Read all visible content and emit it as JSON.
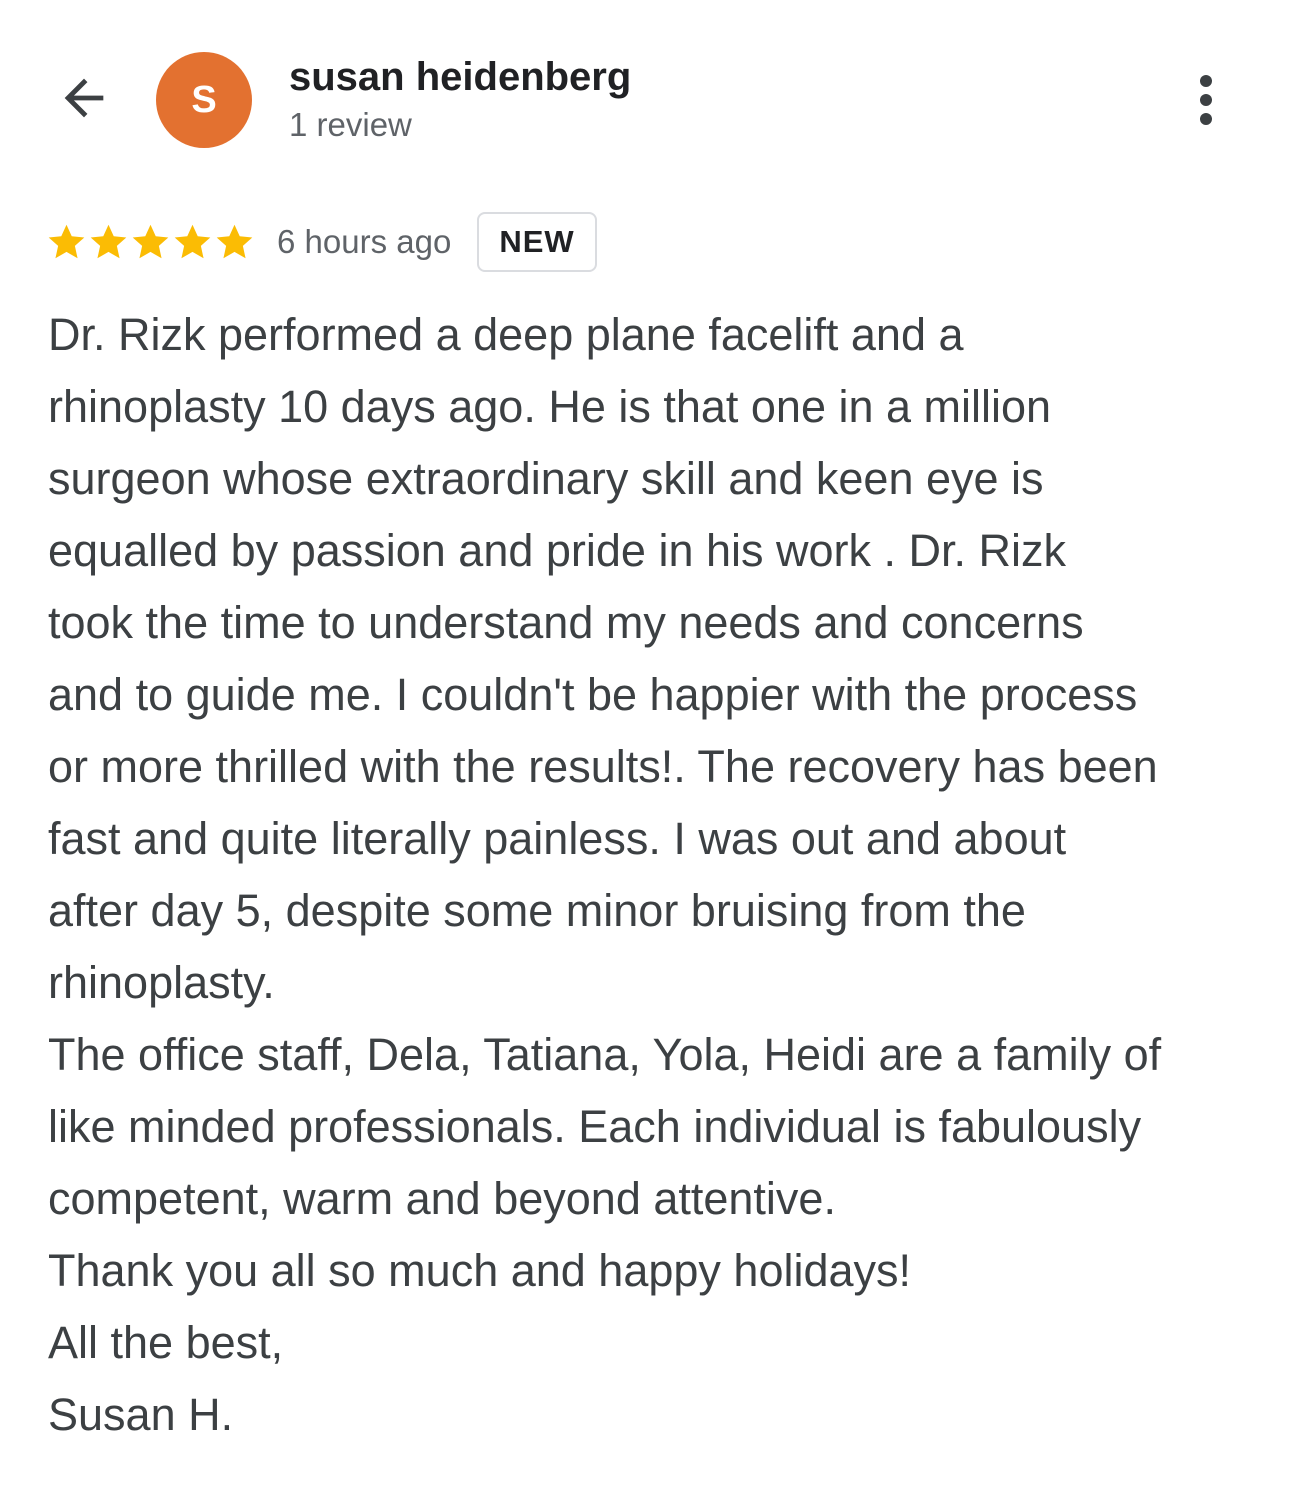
{
  "header": {
    "back_icon": "arrow-left-icon",
    "avatar_initial": "S",
    "avatar_color": "#e37130",
    "reviewer_name": "susan heidenberg",
    "review_count": "1 review",
    "more_icon": "more-vertical-icon"
  },
  "rating": {
    "stars": 5,
    "max_stars": 5,
    "star_color": "#fbbc04",
    "star_icon": "star-icon"
  },
  "meta": {
    "time_ago": "6 hours ago",
    "badge": "NEW"
  },
  "review": {
    "lines": [
      "Dr. Rizk performed a deep plane facelift and a",
      "rhinoplasty 10 days ago. He is that one in a million",
      "surgeon whose extraordinary skill and keen eye is",
      "equalled by passion and pride in his work . Dr. Rizk",
      "took the time to understand my needs and concerns",
      "and to guide me. I couldn't be happier with the process",
      "or more thrilled with the results!. The recovery has been",
      "fast and quite literally painless. I was out and about",
      "after day 5, despite some minor bruising from the",
      "rhinoplasty.",
      "The office staff, Dela, Tatiana, Yola, Heidi are a family of",
      "like minded professionals. Each individual is fabulously",
      "competent, warm and beyond attentive.",
      "Thank you all so much and happy holidays!",
      "All the best,",
      "Susan H."
    ]
  }
}
